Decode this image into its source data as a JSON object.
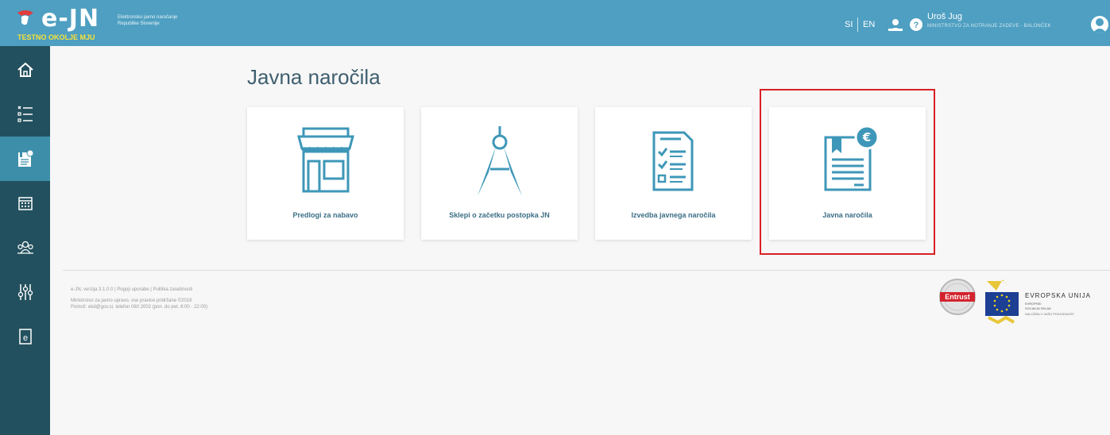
{
  "header": {
    "logo_text": "e-JN",
    "logo_sub_1": "Elektronsko javno naročanje",
    "logo_sub_2": "Republike Slovenije",
    "environment": "TESTNO OKOLJE MJU",
    "lang_si": "SI",
    "lang_en": "EN",
    "user_name": "Uroš Jug",
    "user_org": "MINISTRSTVO ZA NOTRANJE ZADEVE - BALONČEK"
  },
  "sidebar": {
    "items": [
      {
        "icon": "home-icon"
      },
      {
        "icon": "checklist-icon"
      },
      {
        "icon": "procurement-icon",
        "active": true
      },
      {
        "icon": "calendar-icon"
      },
      {
        "icon": "users-icon"
      },
      {
        "icon": "settings-sliders-icon"
      },
      {
        "icon": "document-e-icon"
      }
    ]
  },
  "main": {
    "title": "Javna naročila",
    "cards": [
      {
        "label": "Predlogi za nabavo",
        "icon": "shop-icon"
      },
      {
        "label": "Sklepi o začetku postopka JN",
        "icon": "compass-icon"
      },
      {
        "label": "Izvedba javnega naročila",
        "icon": "checklist-document-icon"
      },
      {
        "label": "Javna naročila",
        "icon": "euro-document-icon"
      }
    ]
  },
  "footer": {
    "line1": "e-JN, verzija 3.1.0.0 | Pogoji uporabe | Politika zasebnosti",
    "line2": "Ministrstvo za javno upravo, vse pravice pridržane ©2019",
    "line3": "Pomoč: ekd@gov.si, telefon 080 2002 (pon. do pet. 8:00 - 22:00)",
    "entrust": "Entrust",
    "eu_title": "EVROPSKA UNIJA",
    "eu_fund_1": "EVROPSKI",
    "eu_fund_2": "SOCIALNI SKLAD",
    "eu_slogan": "NALOŽBA V VAŠO PRIHODNOST"
  },
  "colors": {
    "header": "#4e9fc1",
    "sidebar": "#23505e",
    "sidebar_active": "#3d8ea9",
    "icon": "#3e97b8",
    "highlight": "#d91f26"
  }
}
